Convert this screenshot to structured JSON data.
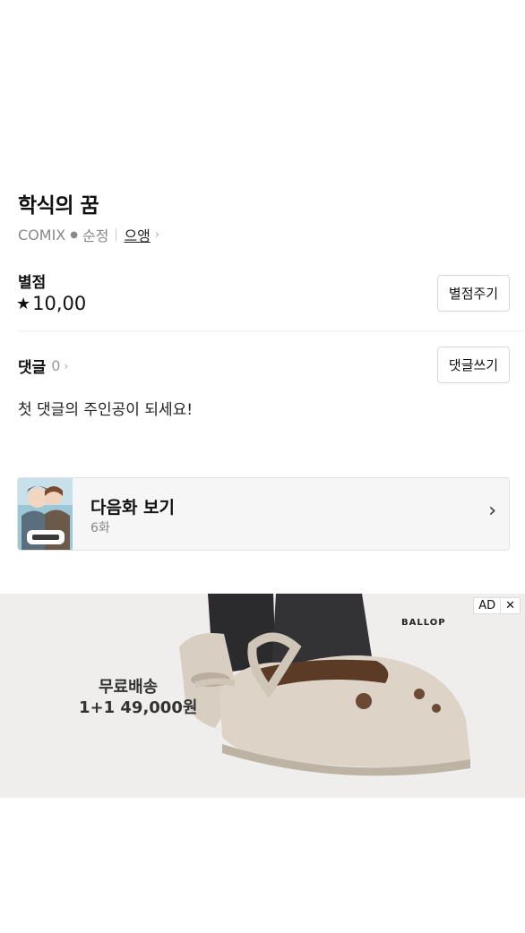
{
  "work": {
    "title": "학식의 꿈",
    "publisher": "COMIX",
    "genre": "순정",
    "author": "으앵"
  },
  "rating": {
    "label": "별점",
    "value": "10,00",
    "button": "별점주기"
  },
  "comments": {
    "label": "댓글",
    "count": "0",
    "button": "댓글쓰기",
    "empty_message": "첫 댓글의 주인공이 되세요!"
  },
  "next_episode": {
    "title": "다음화 보기",
    "episode": "6화"
  },
  "ad": {
    "badge": "AD",
    "close": "✕",
    "brand": "BALLOP",
    "line1": "무료배송",
    "line2": "1+1 49,000원"
  }
}
